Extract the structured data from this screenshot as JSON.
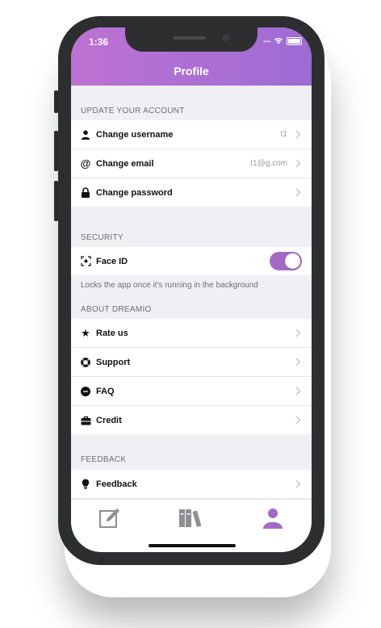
{
  "status_bar": {
    "time": "1:36"
  },
  "header": {
    "title": "Profile"
  },
  "colors": {
    "accent": "#a469c7",
    "header_start": "#bd72d3",
    "header_end": "#9d6cd4"
  },
  "sections": {
    "account": {
      "title": "UPDATE YOUR ACCOUNT",
      "items": [
        {
          "label": "Change username",
          "value": "t1",
          "icon": "user-icon"
        },
        {
          "label": "Change email",
          "value": "t1@g.com",
          "icon": "at-icon"
        },
        {
          "label": "Change password",
          "value": "",
          "icon": "lock-icon"
        }
      ]
    },
    "security": {
      "title": "SECURITY",
      "face_id": {
        "label": "Face ID",
        "enabled": true,
        "icon": "face-id-icon"
      },
      "note": "Locks the app once it's running in the background"
    },
    "about": {
      "title": "ABOUT DREAMIO",
      "items": [
        {
          "label": "Rate us",
          "icon": "star-icon"
        },
        {
          "label": "Support",
          "icon": "lifebuoy-icon"
        },
        {
          "label": "FAQ",
          "icon": "faq-icon"
        },
        {
          "label": "Credit",
          "icon": "briefcase-icon"
        }
      ]
    },
    "feedback": {
      "title": "FEEDBACK",
      "items": [
        {
          "label": "Feedback",
          "icon": "bulb-icon"
        }
      ]
    }
  },
  "tabbar": {
    "tabs": [
      {
        "name": "write",
        "icon": "edit-icon",
        "active": false
      },
      {
        "name": "library",
        "icon": "books-icon",
        "active": false
      },
      {
        "name": "profile",
        "icon": "person-icon",
        "active": true
      }
    ]
  }
}
